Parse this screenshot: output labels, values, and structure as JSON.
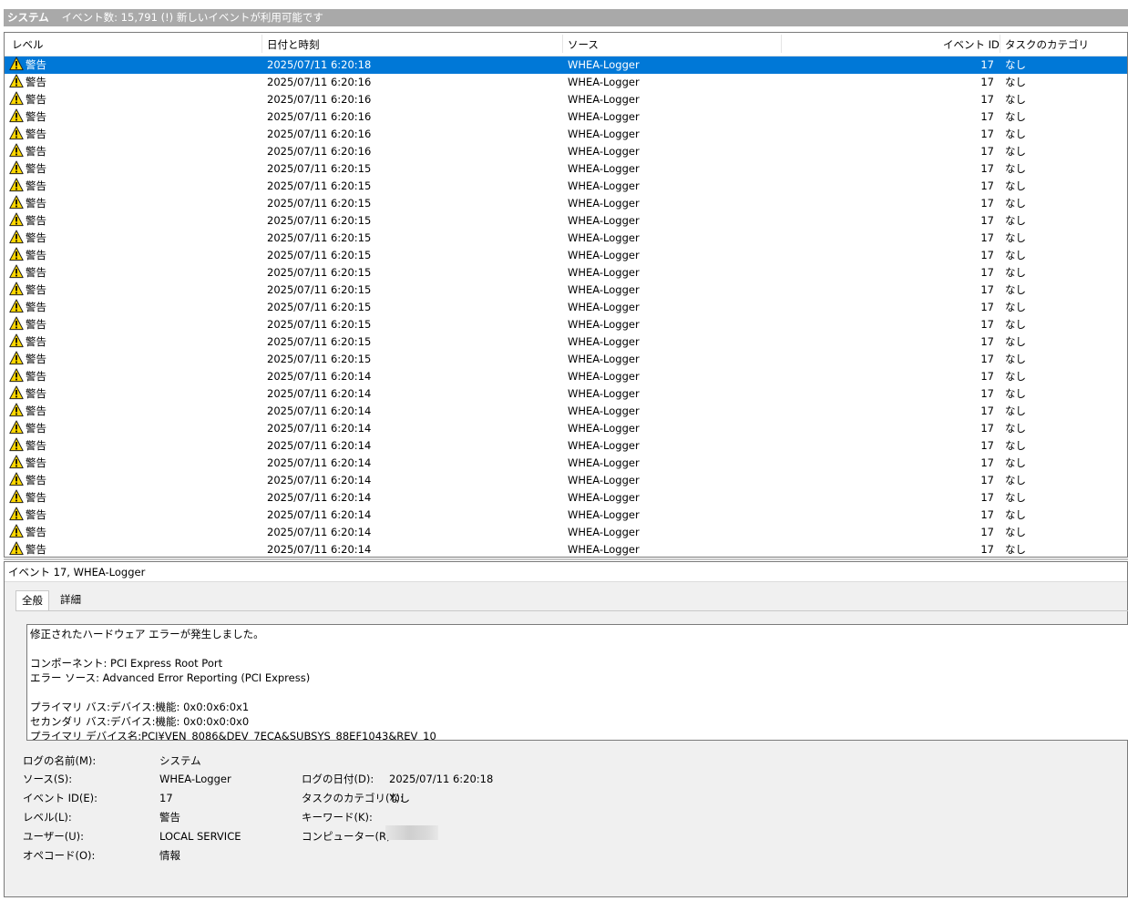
{
  "header": {
    "log_name": "システム",
    "event_count_text": "イベント数: 15,791 (!) 新しいイベントが利用可能です"
  },
  "columns": [
    "レベル",
    "日付と時刻",
    "ソース",
    "イベント ID",
    "タスクのカテゴリ"
  ],
  "rows": [
    {
      "level": "警告",
      "date": "2025/07/11 6:20:18",
      "source": "WHEA-Logger",
      "id": "17",
      "category": "なし",
      "selected": true
    },
    {
      "level": "警告",
      "date": "2025/07/11 6:20:16",
      "source": "WHEA-Logger",
      "id": "17",
      "category": "なし"
    },
    {
      "level": "警告",
      "date": "2025/07/11 6:20:16",
      "source": "WHEA-Logger",
      "id": "17",
      "category": "なし"
    },
    {
      "level": "警告",
      "date": "2025/07/11 6:20:16",
      "source": "WHEA-Logger",
      "id": "17",
      "category": "なし"
    },
    {
      "level": "警告",
      "date": "2025/07/11 6:20:16",
      "source": "WHEA-Logger",
      "id": "17",
      "category": "なし"
    },
    {
      "level": "警告",
      "date": "2025/07/11 6:20:16",
      "source": "WHEA-Logger",
      "id": "17",
      "category": "なし"
    },
    {
      "level": "警告",
      "date": "2025/07/11 6:20:15",
      "source": "WHEA-Logger",
      "id": "17",
      "category": "なし"
    },
    {
      "level": "警告",
      "date": "2025/07/11 6:20:15",
      "source": "WHEA-Logger",
      "id": "17",
      "category": "なし"
    },
    {
      "level": "警告",
      "date": "2025/07/11 6:20:15",
      "source": "WHEA-Logger",
      "id": "17",
      "category": "なし"
    },
    {
      "level": "警告",
      "date": "2025/07/11 6:20:15",
      "source": "WHEA-Logger",
      "id": "17",
      "category": "なし"
    },
    {
      "level": "警告",
      "date": "2025/07/11 6:20:15",
      "source": "WHEA-Logger",
      "id": "17",
      "category": "なし"
    },
    {
      "level": "警告",
      "date": "2025/07/11 6:20:15",
      "source": "WHEA-Logger",
      "id": "17",
      "category": "なし"
    },
    {
      "level": "警告",
      "date": "2025/07/11 6:20:15",
      "source": "WHEA-Logger",
      "id": "17",
      "category": "なし"
    },
    {
      "level": "警告",
      "date": "2025/07/11 6:20:15",
      "source": "WHEA-Logger",
      "id": "17",
      "category": "なし"
    },
    {
      "level": "警告",
      "date": "2025/07/11 6:20:15",
      "source": "WHEA-Logger",
      "id": "17",
      "category": "なし"
    },
    {
      "level": "警告",
      "date": "2025/07/11 6:20:15",
      "source": "WHEA-Logger",
      "id": "17",
      "category": "なし"
    },
    {
      "level": "警告",
      "date": "2025/07/11 6:20:15",
      "source": "WHEA-Logger",
      "id": "17",
      "category": "なし"
    },
    {
      "level": "警告",
      "date": "2025/07/11 6:20:15",
      "source": "WHEA-Logger",
      "id": "17",
      "category": "なし"
    },
    {
      "level": "警告",
      "date": "2025/07/11 6:20:14",
      "source": "WHEA-Logger",
      "id": "17",
      "category": "なし"
    },
    {
      "level": "警告",
      "date": "2025/07/11 6:20:14",
      "source": "WHEA-Logger",
      "id": "17",
      "category": "なし"
    },
    {
      "level": "警告",
      "date": "2025/07/11 6:20:14",
      "source": "WHEA-Logger",
      "id": "17",
      "category": "なし"
    },
    {
      "level": "警告",
      "date": "2025/07/11 6:20:14",
      "source": "WHEA-Logger",
      "id": "17",
      "category": "なし"
    },
    {
      "level": "警告",
      "date": "2025/07/11 6:20:14",
      "source": "WHEA-Logger",
      "id": "17",
      "category": "なし"
    },
    {
      "level": "警告",
      "date": "2025/07/11 6:20:14",
      "source": "WHEA-Logger",
      "id": "17",
      "category": "なし"
    },
    {
      "level": "警告",
      "date": "2025/07/11 6:20:14",
      "source": "WHEA-Logger",
      "id": "17",
      "category": "なし"
    },
    {
      "level": "警告",
      "date": "2025/07/11 6:20:14",
      "source": "WHEA-Logger",
      "id": "17",
      "category": "なし"
    },
    {
      "level": "警告",
      "date": "2025/07/11 6:20:14",
      "source": "WHEA-Logger",
      "id": "17",
      "category": "なし"
    },
    {
      "level": "警告",
      "date": "2025/07/11 6:20:14",
      "source": "WHEA-Logger",
      "id": "17",
      "category": "なし"
    },
    {
      "level": "警告",
      "date": "2025/07/11 6:20:14",
      "source": "WHEA-Logger",
      "id": "17",
      "category": "なし"
    }
  ],
  "detail": {
    "title": "イベント 17, WHEA-Logger",
    "tabs": [
      "全般",
      "詳細"
    ],
    "message_lines": [
      "修正されたハードウェア エラーが発生しました。",
      "",
      "コンポーネント: PCI Express Root Port",
      "エラー ソース: Advanced Error Reporting (PCI Express)",
      "",
      "プライマリ バス:デバイス:機能: 0x0:0x6:0x1",
      "セカンダリ バス:デバイス:機能: 0x0:0x0:0x0",
      "プライマリ デバイス名:PCI¥VEN_8086&DEV_7ECA&SUBSYS_88EF1043&REV_10"
    ],
    "props": {
      "log_name_label": "ログの名前(M):",
      "log_name": "システム",
      "source_label": "ソース(S):",
      "source": "WHEA-Logger",
      "event_id_label": "イベント ID(E):",
      "event_id": "17",
      "level_label": "レベル(L):",
      "level": "警告",
      "user_label": "ユーザー(U):",
      "user": "LOCAL SERVICE",
      "opcode_label": "オペコード(O):",
      "opcode": "情報",
      "logged_label": "ログの日付(D):",
      "logged": "2025/07/11 6:20:18",
      "category_label": "タスクのカテゴリ(Y):",
      "category": "なし",
      "keywords_label": "キーワード(K):",
      "computer_label": "コンピューター(R):"
    }
  },
  "colors": {
    "selection": "#0078d7",
    "titlebar": "#a9a9a9",
    "warning": "#ffd700"
  },
  "icons": {
    "level_icon": "warning-triangle-icon"
  }
}
